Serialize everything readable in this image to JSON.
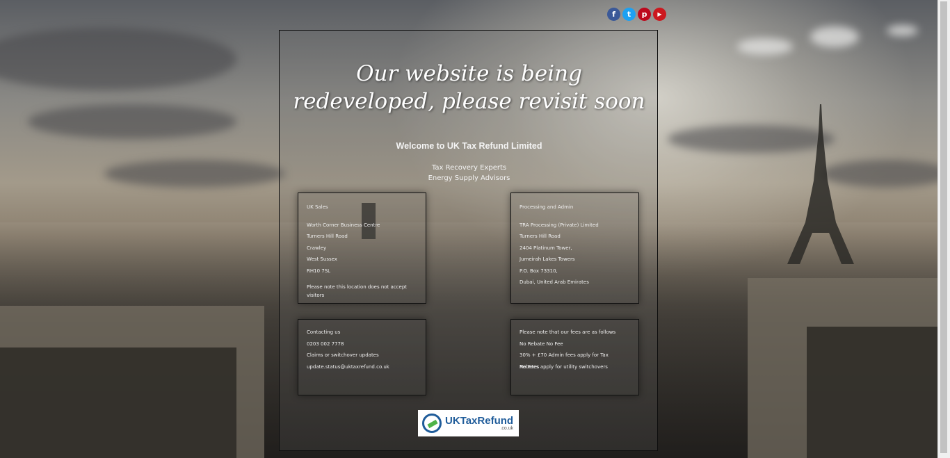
{
  "social": [
    {
      "name": "facebook-icon",
      "glyph": "f",
      "color": "#3b5998"
    },
    {
      "name": "twitter-icon",
      "glyph": "t",
      "color": "#1da1f2"
    },
    {
      "name": "pinterest-icon",
      "glyph": "p",
      "color": "#bd081c"
    },
    {
      "name": "youtube-icon",
      "glyph": "▶",
      "color": "#cc181e"
    }
  ],
  "headline": "Our website is being redeveloped, please revisit soon",
  "welcome": "Welcome to UK Tax Refund Limited",
  "taglines": [
    "Tax Recovery Experts",
    "Energy Supply Advisors"
  ],
  "uk_sales": {
    "title": "UK Sales",
    "lines": [
      "Worth Corner Business Centre",
      "Turners Hill Road",
      "Crawley",
      "West Sussex",
      "RH10 7SL"
    ],
    "note": "Please note this location does not accept visitors"
  },
  "processing": {
    "title": "Processing and Admin",
    "lines": [
      "TRA Processing (Private) Limited",
      "Turners Hill Road",
      "2404 Platinum Tower,",
      "Jumeirah Lakes Towers",
      "P.O. Box 73310,",
      "Dubai, United Arab Emirates"
    ]
  },
  "contact": {
    "lines": [
      "Contacting us",
      "0203 002 7778",
      "Claims or switchover updates",
      "update.status@uktaxrefund.co.uk"
    ]
  },
  "fees": {
    "lines": [
      "Please note that our fees are as follows",
      "No Rebate No Fee",
      "30% + £70 Admin fees apply for Tax Rebates",
      "No Fees apply for utility switchovers"
    ]
  },
  "logo": {
    "brand": "UKTaxRefund",
    "suffix": ".co.uk"
  }
}
